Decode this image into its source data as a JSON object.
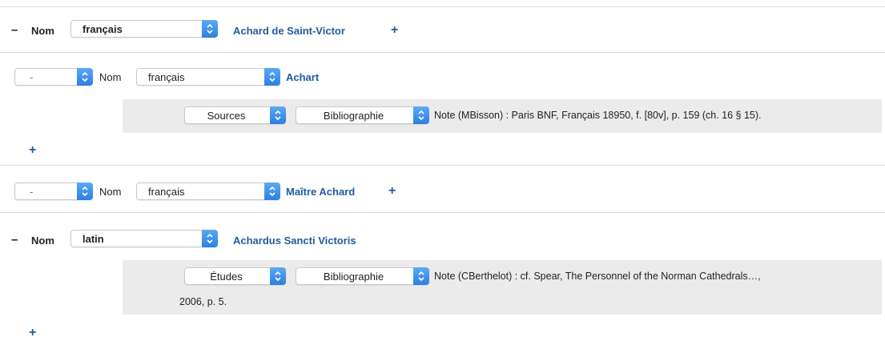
{
  "entries": [
    {
      "toggle": "–",
      "nom_label": "Nom",
      "language": "français",
      "name": "Achard de Saint-Victor",
      "add": "+"
    },
    {
      "type_select": "-",
      "nom_label": "Nom",
      "language": "français",
      "name": "Achart",
      "source": {
        "category": "Sources",
        "kind": "Bibliographie",
        "note": "Note (MBisson) : Paris BNF, Français 18950, f. [80v], p. 159 (ch. 16 § 15)."
      },
      "add": "+"
    },
    {
      "type_select": "-",
      "nom_label": "Nom",
      "language": "français",
      "name": "Maître Achard",
      "add": "+"
    },
    {
      "toggle": "–",
      "nom_label": "Nom",
      "language": "latin",
      "name": "Achardus Sancti Victoris",
      "source": {
        "category": "Études",
        "kind": "Bibliographie",
        "note_line1": "Note (CBerthelot) : cf. Spear, The Personnel of the Norman Cathedrals…,",
        "note_line2": "2006, p. 5."
      },
      "add": "+"
    }
  ],
  "icons": {
    "select_arrow": "chevron-updown-icon",
    "add": "plus-icon",
    "collapse": "minus-icon"
  },
  "colors": {
    "link": "#1e5c9b",
    "select_arrow": "#3a8ae8",
    "panel": "#ebebeb"
  }
}
